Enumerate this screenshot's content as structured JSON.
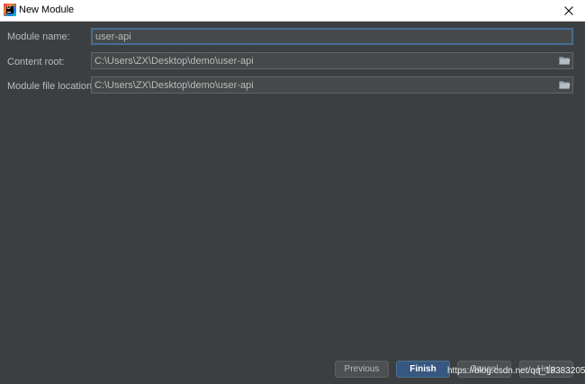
{
  "window": {
    "title": "New Module",
    "icon": "intellij-idea-icon",
    "close_icon": "close-icon"
  },
  "form": {
    "module_name": {
      "label": "Module name:",
      "value": "user-api"
    },
    "content_root": {
      "label": "Content root:",
      "value": "C:\\Users\\ZX\\Desktop\\demo\\user-api",
      "browse_icon": "folder-icon"
    },
    "module_file_location": {
      "label": "Module file location:",
      "value": "C:\\Users\\ZX\\Desktop\\demo\\user-api",
      "browse_icon": "folder-icon"
    }
  },
  "footer": {
    "previous_label": "Previous",
    "finish_label": "Finish",
    "cancel_label": "Cancel",
    "help_label": "Help"
  },
  "watermark": "https://blog.csdn.net/qq_18383205",
  "colors": {
    "background": "#3c3f41",
    "field_background": "#45494a",
    "focus_border": "#466d94",
    "default_button": "#365880",
    "text": "#bbbbbb"
  }
}
